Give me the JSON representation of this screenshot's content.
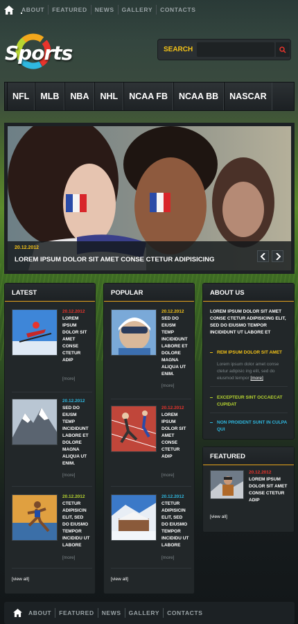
{
  "nav": {
    "home_icon": "home-icon",
    "items": [
      "ABOUT",
      "FEATURED",
      "NEWS",
      "GALLERY",
      "CONTACTS"
    ]
  },
  "logo": {
    "text": "Sports"
  },
  "search": {
    "label": "SEARCH",
    "value": "",
    "icon": "search-icon"
  },
  "sports_menu": [
    "NFL",
    "MLB",
    "NBA",
    "NHL",
    "NCAA FB",
    "NCAA BB",
    "NASCAR"
  ],
  "hero": {
    "date": "20.12.2012",
    "title": "LOREM IPSUM DOLOR SIT AMET CONSE CTETUR ADIPISICING",
    "prev_icon": "chevron-left-icon",
    "next_icon": "chevron-right-icon"
  },
  "latest": {
    "title": "LATEST",
    "items": [
      {
        "date": "20.12.2012",
        "text": "LOREM IPSUM DOLOR SIT AMET CONSE CTETUR ADIP",
        "more": "[more]"
      },
      {
        "date": "20.12.2012",
        "text": "SED DO EIUSM TEMP INCIDIDUNT LABORE ET DOLORE MAGNA ALIQUA UT ENIM.",
        "more": "[more]"
      },
      {
        "date": "20.12.2012",
        "text": "CTETUR ADIPISICIN ELIT, SED DO EIUSMO TEMPOR INCIDIDU UT LABORE",
        "more": "[more]"
      }
    ],
    "view_all": "[view all]"
  },
  "popular": {
    "title": "POPULAR",
    "items": [
      {
        "date": "20.12.2012",
        "text": "SED DO EIUSM TEMP INCIDIDUNT LABORE ET DOLORE MAGNA ALIQUA UT ENIM.",
        "more": "[more]"
      },
      {
        "date": "20.12.2012",
        "text": "LOREM IPSUM DOLOR SIT AMET CONSE CTETUR ADIP",
        "more": "[more]"
      },
      {
        "date": "20.12.2012",
        "text": "CTETUR ADIPISICIN ELIT, SED DO EIUSMO TEMPOR INCIDIDU UT LABORE",
        "more": "[more]"
      }
    ],
    "view_all": "[view all]"
  },
  "about": {
    "title": "ABOUT US",
    "text": "LOREM IPSUM DOLOR SIT AMET CONSE CTETUR ADIPISICING ELIT, SED DO EIUSMO TEMPOR INCIDIDUNT UT LABORE ET",
    "link1": "REM IPSUM DOLOR SIT AMET",
    "link1_sub": "Lorem ipsum dolor amet conse ctetur adipisic ing elit, sed do eiusmod tempor",
    "link1_more": "[more]",
    "link2": "EXCEPTEUR SINT OCCAECAT CUPIDAT",
    "link3": "NON PROIDENT SUNT IN CULPA QUI"
  },
  "featured": {
    "title": "FEATURED",
    "date": "20.12.2012",
    "text": "LOREM IPSUM DOLOR SIT AMET CONSE CTETUR ADIP",
    "view_all": "[view all]"
  },
  "footer_nav": [
    "ABOUT",
    "FEATURED",
    "NEWS",
    "GALLERY",
    "CONTACTS"
  ],
  "colors": {
    "accent_yellow": "#f3c218",
    "accent_red": "#e8342c",
    "accent_blue": "#2fb8e0",
    "accent_green": "#b8d630",
    "accent_orange": "#e8a51c"
  }
}
